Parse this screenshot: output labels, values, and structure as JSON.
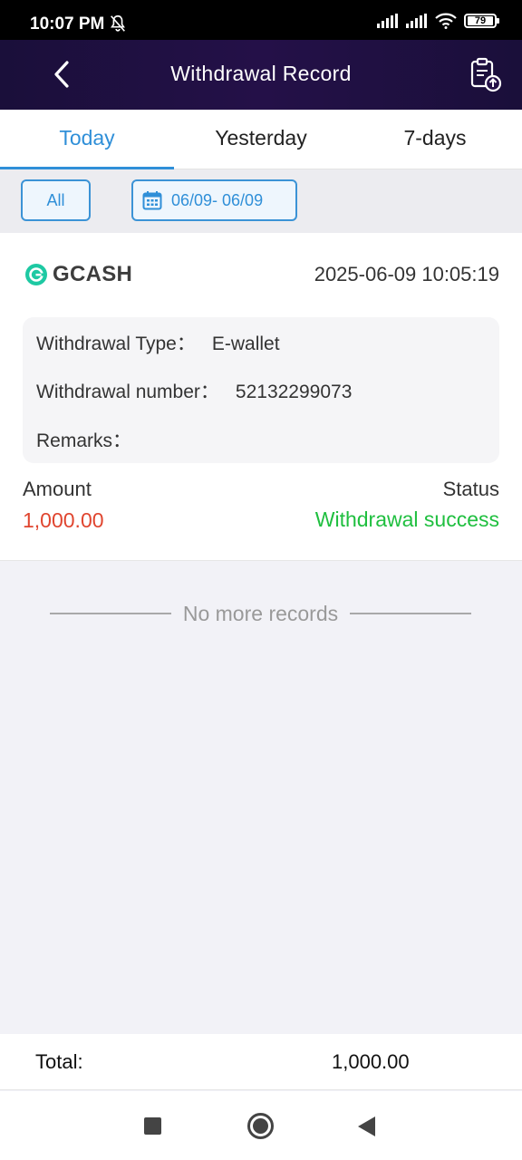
{
  "status_bar": {
    "time": "10:07 PM",
    "battery": "79"
  },
  "header": {
    "title": "Withdrawal Record"
  },
  "tabs": [
    {
      "label": "Today",
      "active": true
    },
    {
      "label": "Yesterday",
      "active": false
    },
    {
      "label": "7-days",
      "active": false
    }
  ],
  "filters": {
    "all_label": "All",
    "date_range": "06/09- 06/09"
  },
  "record": {
    "provider": "GCASH",
    "datetime": "2025-06-09 10:05:19",
    "type_label": "Withdrawal Type：",
    "type_value": "E-wallet",
    "number_label": "Withdrawal number：",
    "number_value": "52132299073",
    "remarks_label": "Remarks：",
    "remarks_value": "",
    "amount_label": "Amount",
    "amount_value": "1,000.00",
    "status_label": "Status",
    "status_value": "Withdrawal success"
  },
  "list_end": {
    "text": "No more records"
  },
  "total": {
    "label": "Total:",
    "value": "1,000.00"
  },
  "colors": {
    "accent": "#2f8fd8",
    "header_bg": "#1f1143",
    "amount": "#e0452f",
    "success": "#1fbf3f",
    "gcash": "#1ec9a3"
  }
}
